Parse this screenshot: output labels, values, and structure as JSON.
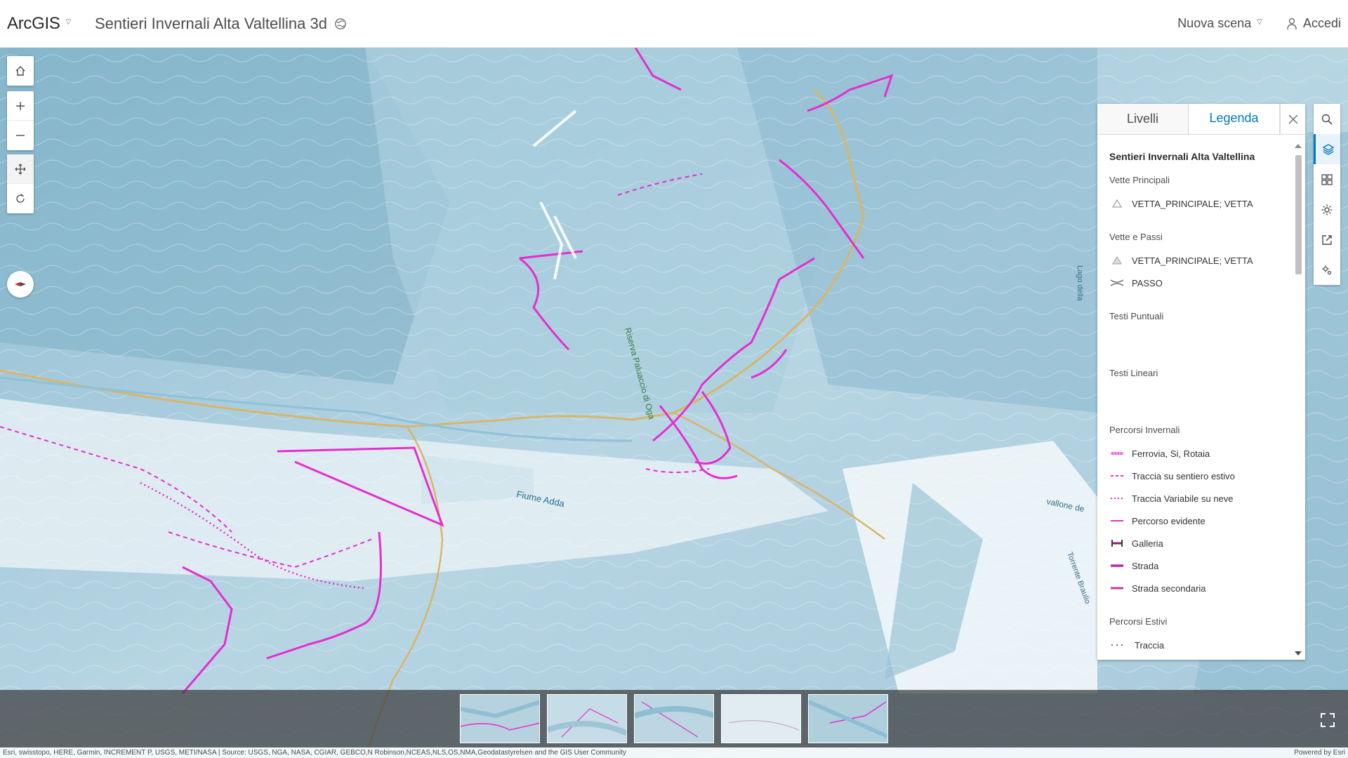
{
  "header": {
    "brand": "ArcGIS",
    "scene_title": "Sentieri Invernali Alta Valtellina 3d",
    "new_scene": "Nuova scena",
    "sign_in": "Accedi"
  },
  "panel": {
    "tabs": [
      {
        "label": "Livelli",
        "active": false
      },
      {
        "label": "Legenda",
        "active": true
      }
    ],
    "legend_title": "Sentieri Invernali Alta Valtellina",
    "layers": {
      "vette_principali": {
        "name": "Vette Principali",
        "items": [
          "VETTA_PRINCIPALE; VETTA"
        ]
      },
      "vette_passi": {
        "name": "Vette e Passi",
        "items": [
          "VETTA_PRINCIPALE; VETTA",
          "PASSO"
        ]
      },
      "testi_puntuali": {
        "name": "Testi Puntuali"
      },
      "testi_lineari": {
        "name": "Testi Lineari"
      },
      "percorsi_invernali": {
        "name": "Percorsi Invernali",
        "items": [
          "Ferrovia, Si, Rotaia",
          "Traccia su sentiero estivo",
          "Traccia Variabile su neve",
          "Percorso evidente",
          "Galleria",
          "Strada",
          "Strada secondaria"
        ]
      },
      "percorsi_estivi": {
        "name": "Percorsi Estivi",
        "items": [
          "Traccia"
        ]
      }
    }
  },
  "map_labels": {
    "river": "Fiume Adda",
    "reserve": "Riserva Paluaccio di Oga",
    "valley": "vallone de",
    "lake": "Lago della",
    "torrent": "Torrente Braulio"
  },
  "attribution": {
    "sources": "Esri, swisstopo, HERE, Garmin, INCREMENT P, USGS, METI/NASA | Source: USGS, NGA, NASA, CGIAR, GEBCO,N Robinson,NCEAS,NLS,OS,NMA,Geodatastyrelsen and the GIS User Community",
    "powered": "Powered by Esri"
  },
  "colors": {
    "accent": "#0079c1",
    "trail": "#e52ecf",
    "road": "#d9b56a",
    "snow": "#dcebf2",
    "shadow": "#7fb1c8"
  },
  "icons": {
    "nav": [
      "home-icon",
      "zoom-in-icon",
      "zoom-out-icon",
      "pan-icon",
      "rotate-icon",
      "compass-icon"
    ],
    "toolbar": [
      "search-icon",
      "layers-icon",
      "basemap-gallery-icon",
      "settings-icon",
      "share-icon",
      "tools-icon"
    ]
  }
}
